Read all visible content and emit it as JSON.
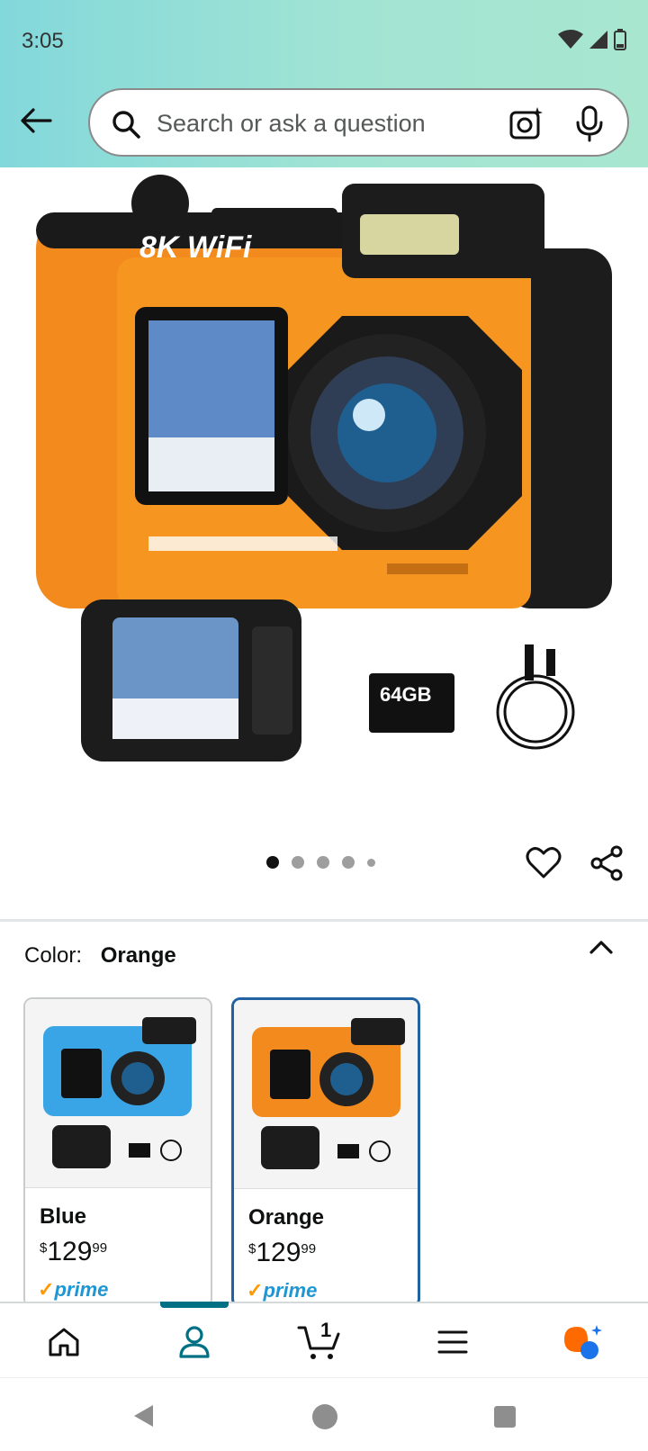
{
  "status_bar": {
    "time": "3:05"
  },
  "search": {
    "placeholder": "Search or ask a question"
  },
  "product": {
    "image_description_icon": "camera-product-image",
    "image_labels": {
      "brand_badge": "8K WiFi",
      "sd_card": "64GB"
    },
    "carousel": {
      "total": 5,
      "active_index": 0
    }
  },
  "color_selector": {
    "label": "Color:",
    "selected": "Orange",
    "options": [
      {
        "name": "Blue",
        "price_symbol": "$",
        "price_whole": "129",
        "price_fraction": "99",
        "prime": "prime",
        "accent": "#3aa5e6"
      },
      {
        "name": "Orange",
        "price_symbol": "$",
        "price_whole": "129",
        "price_fraction": "99",
        "prime": "prime",
        "accent": "#f28a1e"
      }
    ]
  },
  "bottom_nav": {
    "items": [
      "home-icon",
      "account-icon",
      "cart-icon",
      "menu-icon",
      "rufus-icon"
    ],
    "active": "account-icon",
    "cart_count": "1"
  },
  "colors": {
    "accent": "#007185",
    "selected_border": "#2162a1",
    "prime_blue": "#1f97d4",
    "prime_check": "#ff9900"
  }
}
